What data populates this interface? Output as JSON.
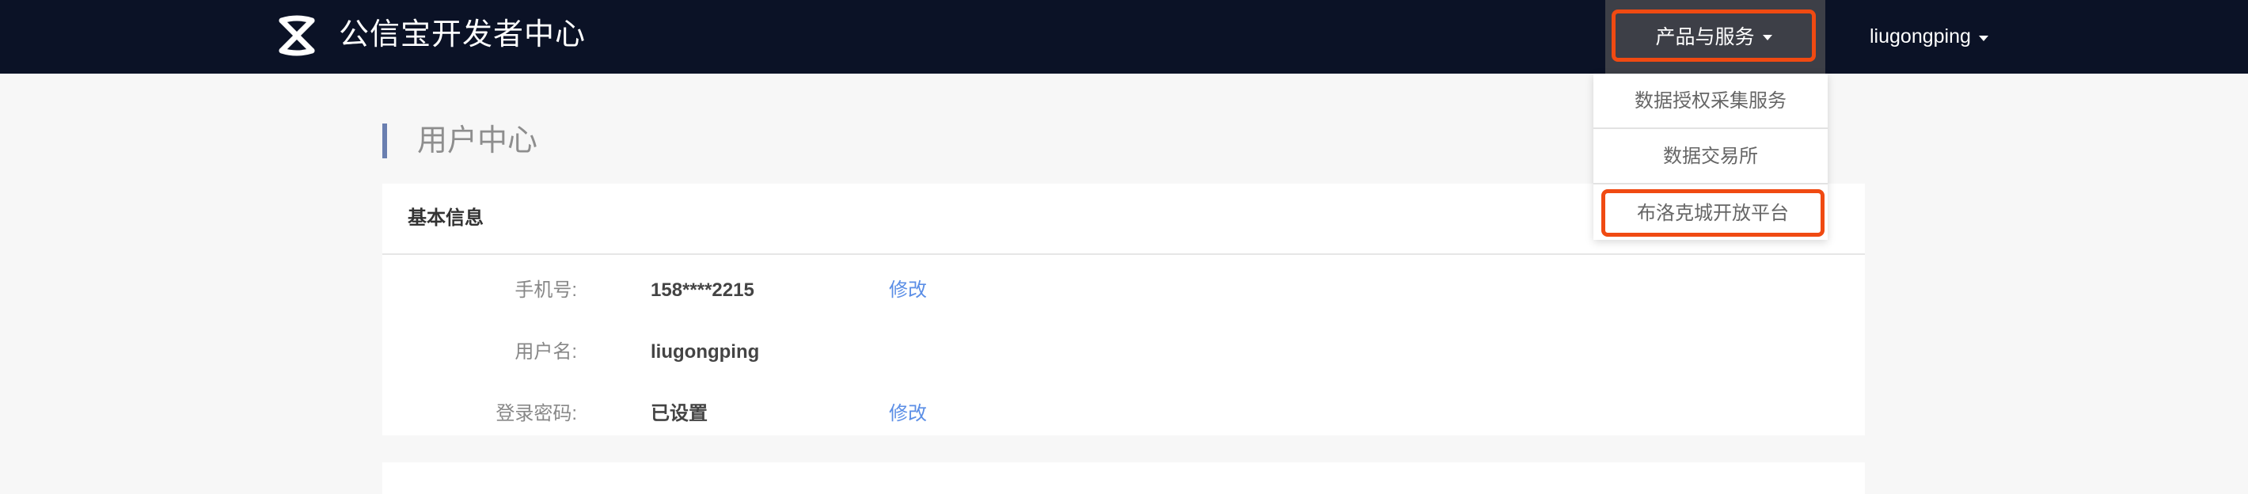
{
  "header": {
    "brand": "公信宝开发者中心",
    "logo_icon": "x-knot-logo-icon",
    "products_menu_label": "产品与服务",
    "user_menu_label": "liugongping"
  },
  "products_dropdown": {
    "items": [
      {
        "label": "数据授权采集服务"
      },
      {
        "label": "数据交易所"
      },
      {
        "label": "布洛克城开放平台",
        "highlighted": true
      }
    ]
  },
  "page": {
    "title": "用户中心"
  },
  "basic_info": {
    "title": "基本信息",
    "rows": [
      {
        "label": "手机号:",
        "value": "158****2215",
        "action": "修改"
      },
      {
        "label": "用户名:",
        "value": "liugongping"
      },
      {
        "label": "登录密码:",
        "value": "已设置",
        "action": "修改"
      }
    ]
  },
  "colors": {
    "topbar_bg": "#0b1226",
    "accent_highlight": "#f04a12",
    "link": "#5b8ee6",
    "title_bar": "#6a7fb0"
  }
}
